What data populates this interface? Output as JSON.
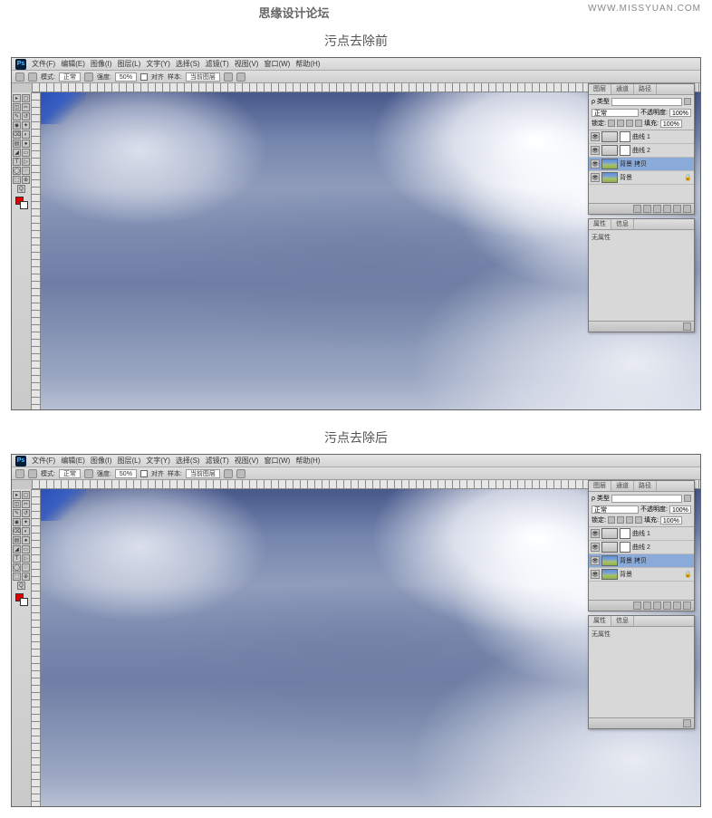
{
  "header": {
    "brand": "思缘设计论坛",
    "url": "WWW.MISSYUAN.COM"
  },
  "captions": {
    "before": "污点去除前",
    "after": "污点去除后"
  },
  "menu": {
    "items": [
      "文件(F)",
      "编辑(E)",
      "图像(I)",
      "图层(L)",
      "文字(Y)",
      "选择(S)",
      "滤镜(T)",
      "视图(V)",
      "窗口(W)",
      "帮助(H)"
    ]
  },
  "options": {
    "mode_label": "模式:",
    "mode": "正常",
    "size_label": "",
    "size": "",
    "strength_label": "强度:",
    "strength": "50%",
    "sample_label": "样本:",
    "sample": "当前图层",
    "aligned": "对齐",
    "flow_label": "",
    "pressure": ""
  },
  "tools": [
    "▸",
    "▢",
    "◫",
    "✂",
    "✎",
    "↺",
    "◉",
    "✦",
    "⌫",
    "◐",
    "▤",
    "●",
    "◢",
    "▭",
    "T",
    "▷",
    "◯",
    "☞",
    "⬚",
    "⊕",
    "Q"
  ],
  "layers_panel": {
    "tabs": [
      "图层",
      "通道",
      "路径"
    ],
    "kind_label": "ρ 类型",
    "kind": "",
    "opacity_label": "不透明度:",
    "opacity": "100%",
    "blend": "正常",
    "lock_label": "锁定:",
    "fill_label": "填充:",
    "fill": "100%",
    "rows": [
      {
        "name": "曲线 1",
        "type": "curves"
      },
      {
        "name": "曲线 2",
        "type": "curves"
      },
      {
        "name": "背景 拷贝",
        "type": "img",
        "selected": true
      },
      {
        "name": "背景",
        "type": "img",
        "locked": true
      }
    ]
  },
  "props_panel": {
    "tabs": [
      "属性",
      "信息"
    ],
    "body": "无属性"
  }
}
